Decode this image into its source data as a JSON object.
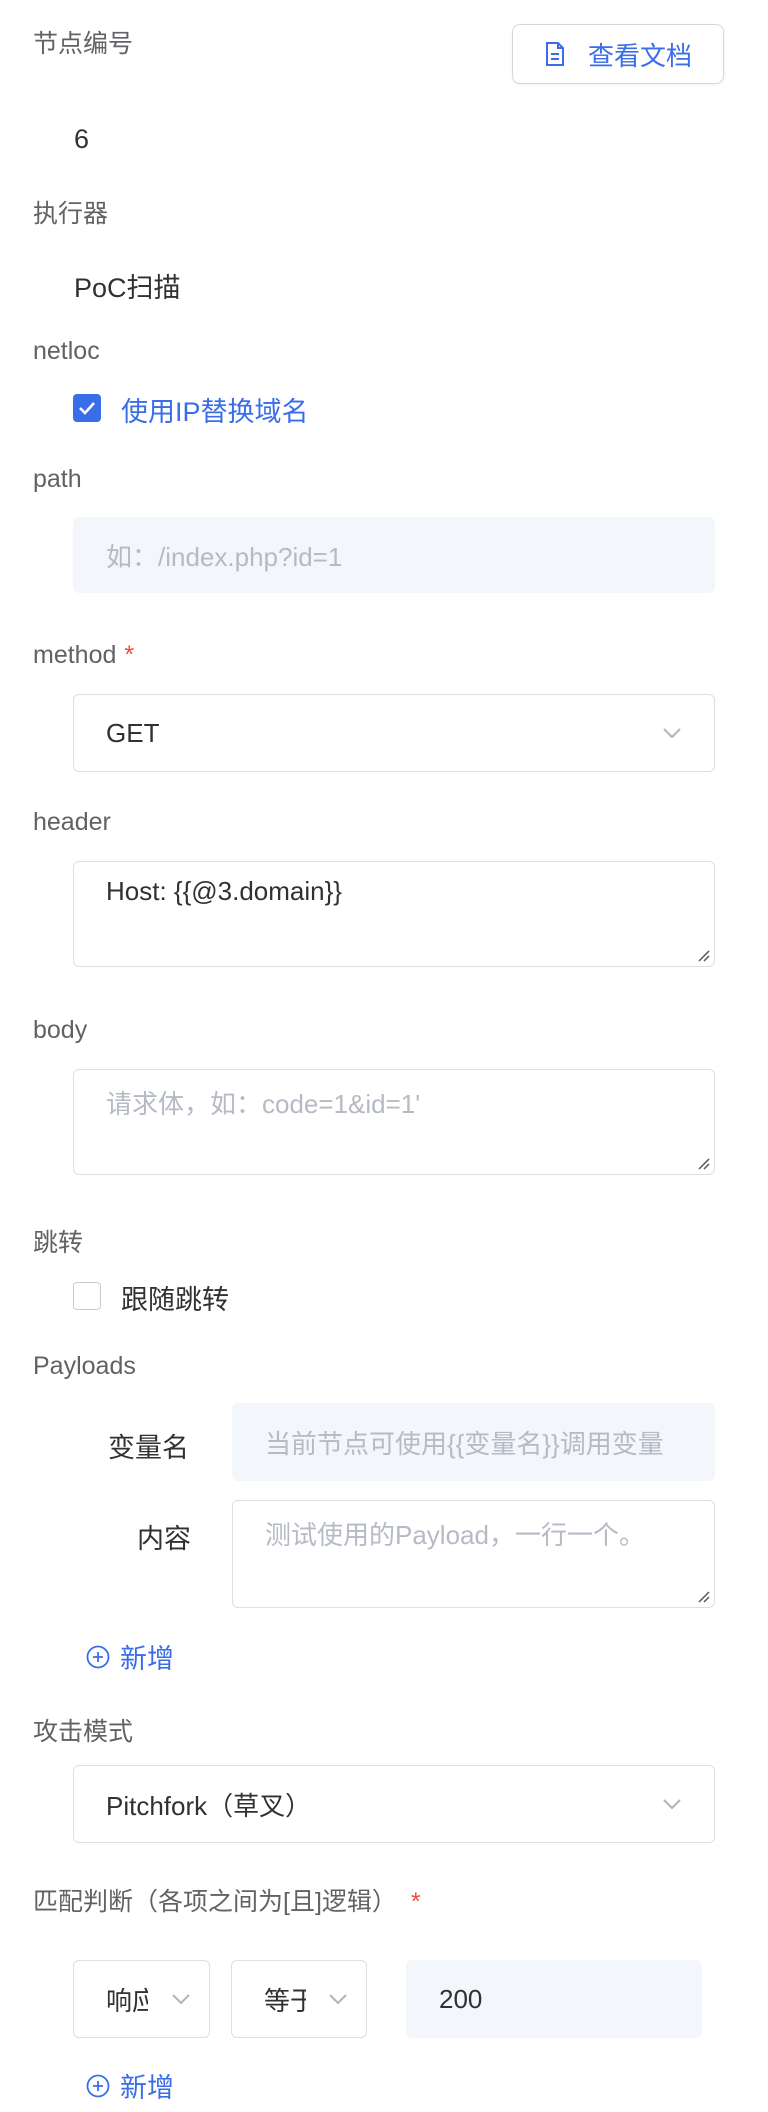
{
  "doc_button": {
    "label": "查看文档",
    "icon": "document-icon"
  },
  "node_id": {
    "label": "节点编号",
    "value": "6"
  },
  "executor": {
    "label": "执行器",
    "value": "PoC扫描"
  },
  "netloc": {
    "label": "netloc",
    "checkbox_label": "使用IP替换域名",
    "checked": true
  },
  "path": {
    "label": "path",
    "placeholder": "如：/index.php?id=1"
  },
  "method": {
    "label": "method",
    "required_mark": "*",
    "value": "GET"
  },
  "header": {
    "label": "header",
    "value": "Host: {{@3.domain}}"
  },
  "body": {
    "label": "body",
    "placeholder": "请求体，如：code=1&id=1'"
  },
  "redirect": {
    "label": "跳转",
    "checkbox_label": "跟随跳转",
    "checked": false
  },
  "payloads": {
    "label": "Payloads",
    "var_label": "变量名",
    "var_placeholder": "当前节点可使用{{变量名}}调用变量",
    "content_label": "内容",
    "content_placeholder": "测试使用的Payload，一行一个。",
    "add_label": "新增"
  },
  "attack_mode": {
    "label": "攻击模式",
    "value": "Pitchfork（草叉）"
  },
  "match": {
    "label": "匹配判断（各项之间为[且]逻辑）",
    "required_mark": "*",
    "field_value": "响应",
    "operator_value": "等于",
    "match_value": "200",
    "add_label": "新增"
  },
  "colors": {
    "accent": "#3a6ee8",
    "required": "#f04b3c",
    "input_bg": "#f3f6fb"
  }
}
